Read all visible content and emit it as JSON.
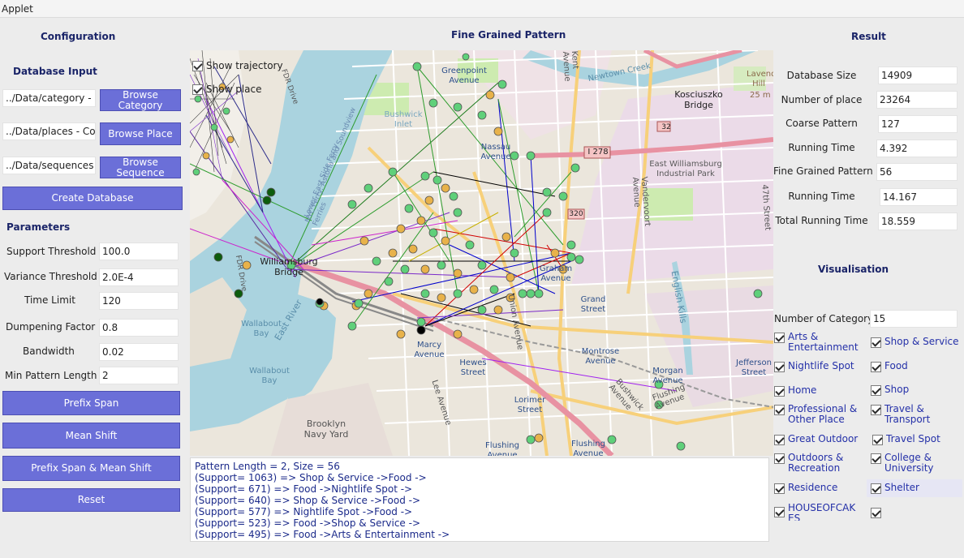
{
  "window": {
    "title": "Applet"
  },
  "config": {
    "heading": "Configuration",
    "db_heading": "Database Input",
    "category_path": "../Data/category - Copy",
    "places_path": "../Data/places - Copy",
    "sequences_path": "../Data/sequences - ",
    "browse_category": "Browse Category",
    "browse_place": "Browse Place",
    "browse_sequence": "Browse Sequence",
    "create_db": "Create Database",
    "params_heading": "Parameters",
    "params": [
      {
        "label": "Support Threshold",
        "value": "100.0"
      },
      {
        "label": "Variance Threshold",
        "value": "2.0E-4"
      },
      {
        "label": "Time Limit",
        "value": "120"
      },
      {
        "label": "Dumpening Factor",
        "value": "0.8"
      },
      {
        "label": "Bandwidth",
        "value": "0.02"
      },
      {
        "label": "Min Pattern Length",
        "value": "2"
      }
    ],
    "prefix_span": "Prefix Span",
    "mean_shift": "Mean Shift",
    "prefix_mean": "Prefix Span & Mean Shift",
    "reset": "Reset"
  },
  "center": {
    "heading": "Fine Grained Pattern",
    "show_trajectory": "Show trajectory",
    "show_place": "Show place",
    "map_labels": {
      "greenpoint": "Greenpoint Avenue",
      "nassau": "Nassau Avenue",
      "bushwick": "Bushwick Inlet",
      "kosciuszko": "Kosciuszko Bridge",
      "east_wb": "East Williamsburg Industrial Park",
      "i278": "I 278",
      "williamsburg": "Williamsburg Bridge",
      "east_river": "East River",
      "wallabout_bay": "Wallabout Bay",
      "wallabout_bay2": "Wallabout Bay",
      "brooklyn_navy": "Brooklyn Navy Yard",
      "graham": "Graham Avenue",
      "grand": "Grand Street",
      "marcy": "Marcy Avenue",
      "hewes": "Hewes Street",
      "lorimer": "Lorimer Street",
      "flushing1": "Flushing Avenue",
      "flushing2": "Flushing Avenue",
      "montrose": "Montrose Avenue",
      "morgan": "Morgan Avenue",
      "jefferson": "Jefferson Street",
      "english_kills": "English Kills",
      "lavender": "Lavender Hill",
      "fdr1": "FDR Drive",
      "fdr2": "FDR Drive",
      "union": "Union Avenue",
      "lee": "Lee Avenue",
      "flushing_ave": "Flushing Avenue",
      "bushwick_ave": "Bushwick Avenue",
      "newtown": "Newtown Creek",
      "vandervoort": "Vandervoort Avenue",
      "47th": "47th Street",
      "kent": "Kent Avenue",
      "ferry": "NYC Ferry: Astoria and Soundview Ferries",
      "island": "Lower East Side Ferry",
      "r32": "32",
      "r320": "320",
      "n25m": "25 m"
    },
    "console": [
      "Pattern Length = 2, Size = 56",
      "(Support= 1063) => Shop & Service ->Food ->",
      "(Support= 671) => Food ->Nightlife Spot ->",
      "(Support= 640) => Shop & Service ->Food ->",
      "(Support= 577) => Nightlife Spot ->Food ->",
      "(Support= 523) => Food ->Shop & Service ->",
      "(Support= 495) => Food ->Arts & Entertainment ->"
    ]
  },
  "result": {
    "heading": "Result",
    "rows": [
      {
        "label": "Database Size",
        "value": "14909"
      },
      {
        "label": "Number of place",
        "value": "23264"
      },
      {
        "label": "Coarse Pattern",
        "value": "127"
      },
      {
        "label": "Running Time",
        "value": "4.392"
      },
      {
        "label": "Fine Grained Pattern",
        "value": "56"
      },
      {
        "label": "Running Time",
        "value": "14.167"
      },
      {
        "label": "Total Running Time",
        "value": "18.559"
      }
    ],
    "vis_heading": "Visualisation",
    "num_cat_label": "Number of Category",
    "num_cat_value": "15",
    "categories": [
      {
        "left": "Arts & Entertainment",
        "right": "Shop & Service"
      },
      {
        "left": "Nightlife Spot",
        "right": "Food"
      },
      {
        "left": "Home",
        "right": "Shop"
      },
      {
        "left": "Professional & Other Place",
        "right": "Travel & Transport"
      },
      {
        "left": "Great Outdoor",
        "right": "Travel Spot"
      },
      {
        "left": "Outdoors & Recreation",
        "right": "College & University"
      },
      {
        "left": "Residence",
        "right": "Shelter"
      },
      {
        "left": "HOUSEOFCAKES",
        "right": ""
      }
    ]
  },
  "colors": {
    "button": "#6b6fd8",
    "heading": "#1a2468",
    "checkbox_text": "#2430a8",
    "water": "#aad3df",
    "park": "#cdebb0",
    "industrial": "#ebdbe8",
    "road_major": "#f7d07a",
    "highway": "#e892a2"
  }
}
